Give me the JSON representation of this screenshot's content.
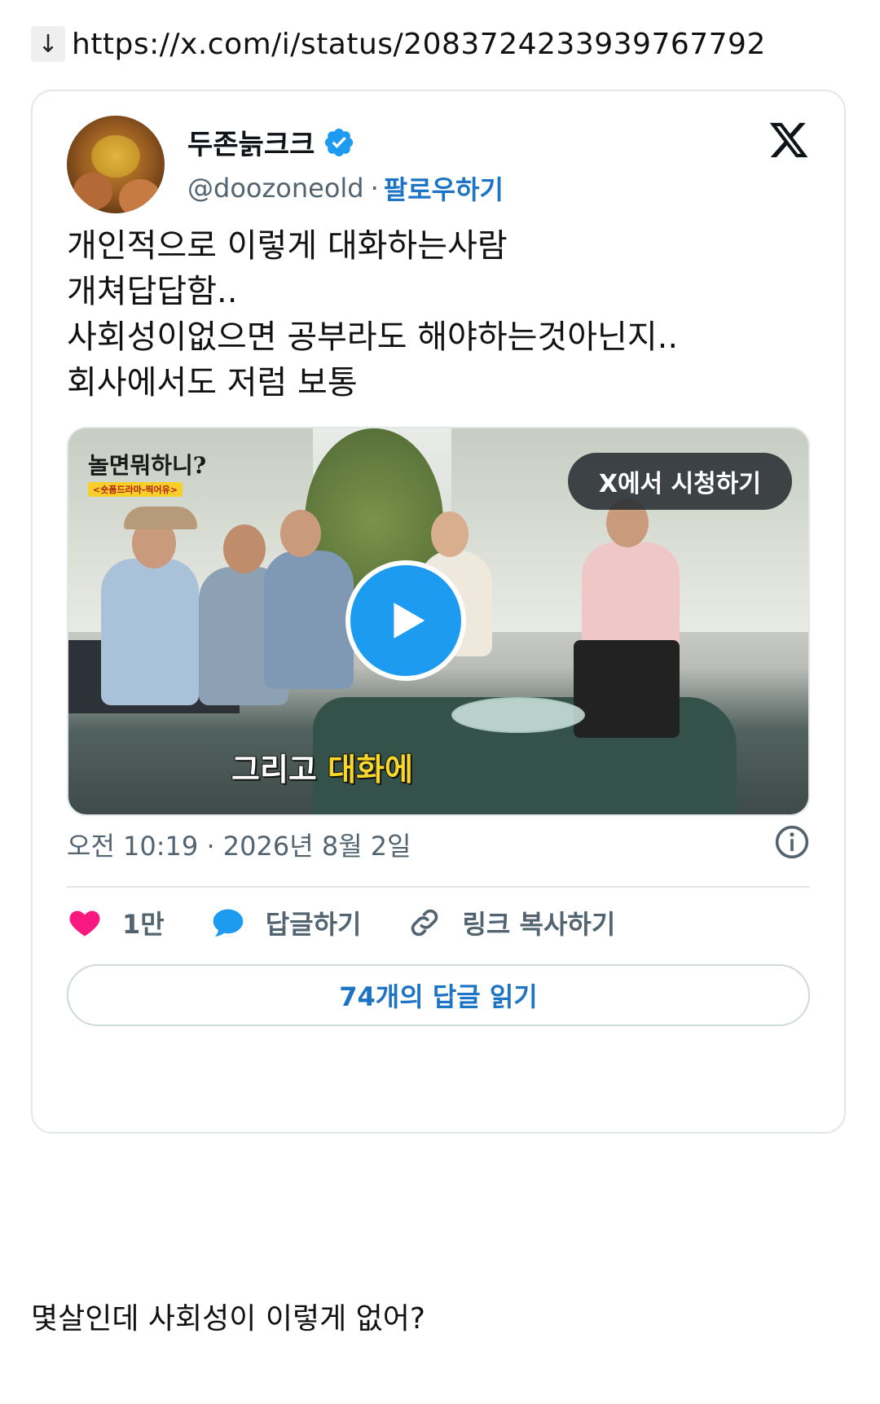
{
  "link": {
    "arrow": "↓",
    "url": "https://x.com/i/status/2083724233939767792"
  },
  "tweet": {
    "display_name": "두존늙크크",
    "verified_icon": "verified-badge-icon",
    "handle": "@doozoneold",
    "separator": "·",
    "follow_label": "팔로우하기",
    "brand_icon": "x-logo-icon",
    "text_lines": [
      "개인적으로 이렇게 대화하는사람",
      "개쳐답답함..",
      "사회성이없으면 공부라도 해야하는것아닌지..",
      "회사에서도 저럼 보통"
    ],
    "video": {
      "show_title": "놀면뭐하니?",
      "show_subtitle": "<숏폼드라마-찍어유>",
      "watch_label": "X에서 시청하기",
      "subtitle_white": "그리고",
      "subtitle_yellow": "대화에",
      "play_icon": "play-icon"
    },
    "timestamp": "오전 10:19 · 2026년 8월 2일",
    "info_icon": "info-icon",
    "actions": {
      "like_count": "1만",
      "reply_label": "답글하기",
      "copy_link_label": "링크 복사하기"
    },
    "read_replies_label": "74개의 답글 읽기",
    "colors": {
      "accent": "#1d74c4",
      "like": "#f91880",
      "reply": "#1d9bf0",
      "muted": "#536471"
    }
  },
  "caption": "몇살인데 사회성이 이렇게 없어?"
}
